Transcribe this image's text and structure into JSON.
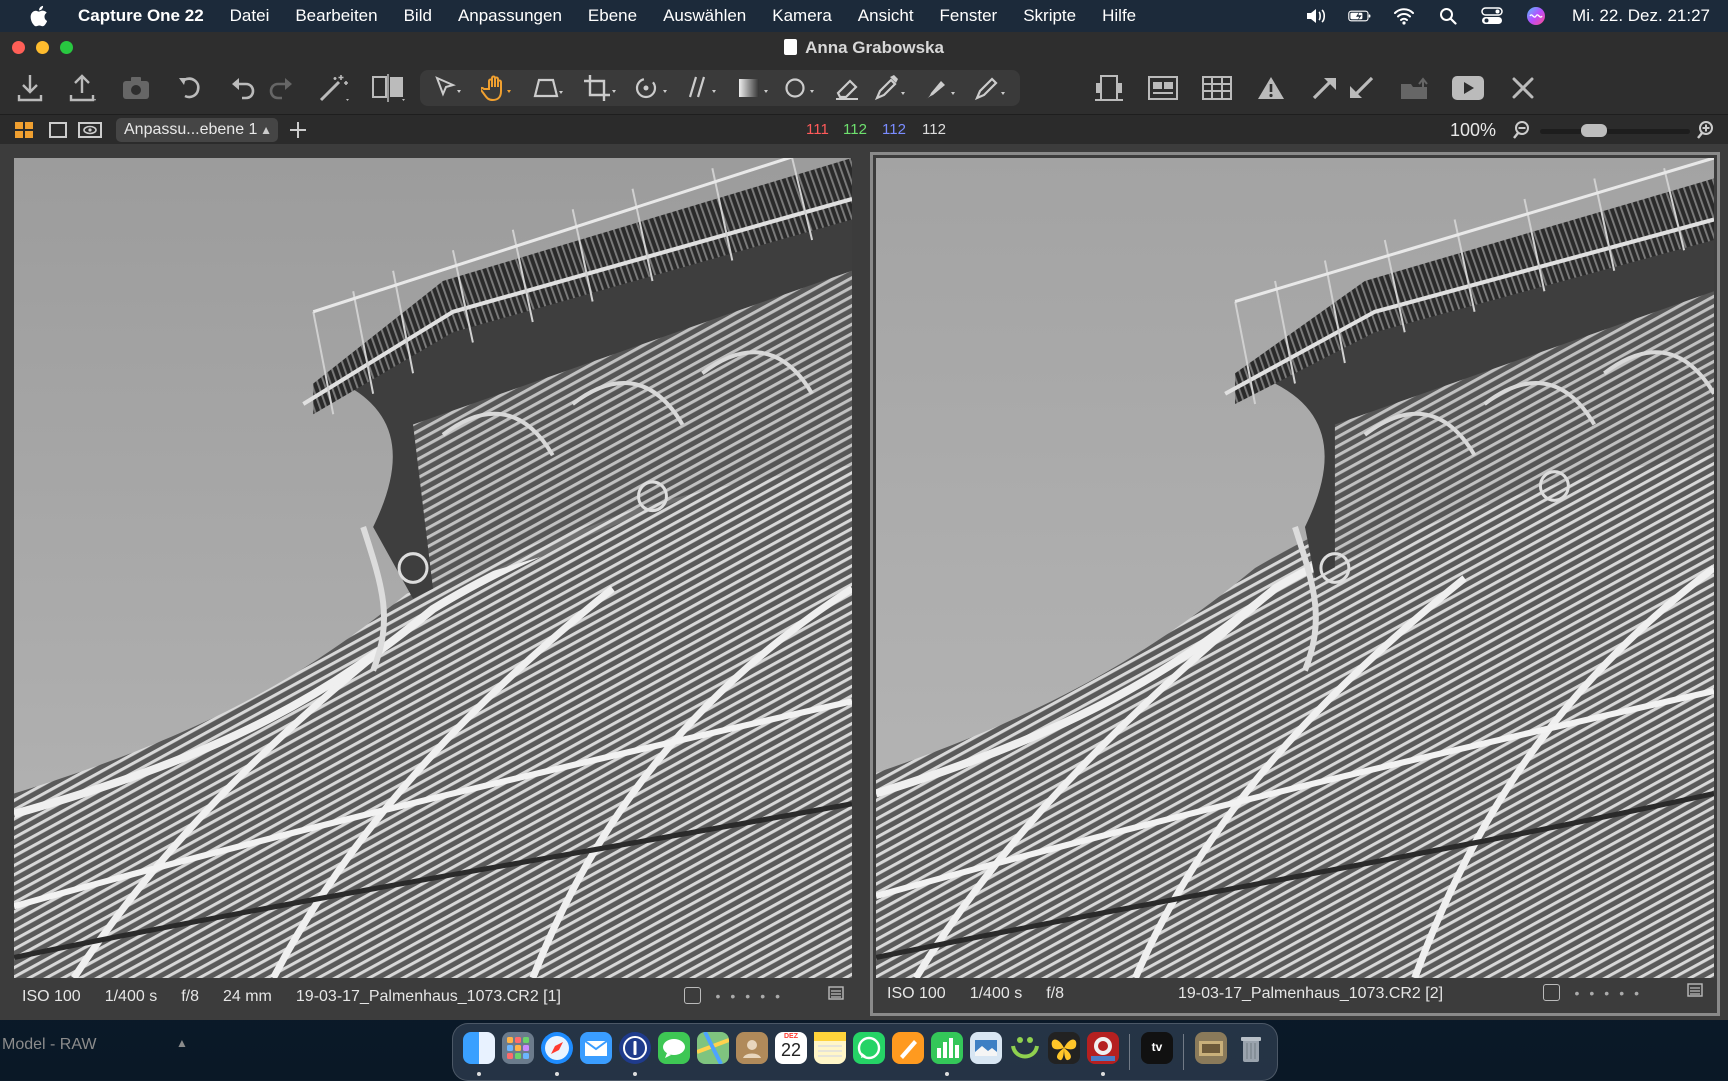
{
  "menubar": {
    "app_name": "Capture One 22",
    "items": [
      "Datei",
      "Bearbeiten",
      "Bild",
      "Anpassungen",
      "Ebene",
      "Auswählen",
      "Kamera",
      "Ansicht",
      "Fenster",
      "Skripte",
      "Hilfe"
    ],
    "datetime": "Mi. 22. Dez.  21:27"
  },
  "window": {
    "title": "Anna Grabowska"
  },
  "subbar": {
    "layer": "Anpassu...ebene 1",
    "rgb": {
      "r": "111",
      "g": "112",
      "b": "112",
      "l": "112"
    },
    "zoom": "100%",
    "zoom_level": 0.33
  },
  "viewer": {
    "left": {
      "iso": "ISO 100",
      "shutter": "1/400 s",
      "aperture": "f/8",
      "focal": "24 mm",
      "filename": "19-03-17_Palmenhaus_1073.CR2 [1]"
    },
    "right": {
      "iso": "ISO 100",
      "shutter": "1/400 s",
      "aperture": "f/8",
      "filename": "19-03-17_Palmenhaus_1073.CR2 [2]"
    }
  },
  "bottombar": {
    "model_label": "Model - RAW"
  },
  "dock": {
    "calendar_month": "DEZ",
    "calendar_day": "22",
    "tv_label": "tv"
  },
  "colors": {
    "red": "#ff5a5a",
    "green": "#6ee06e",
    "blue": "#7a8cff",
    "accent_orange": "#f0a030"
  }
}
